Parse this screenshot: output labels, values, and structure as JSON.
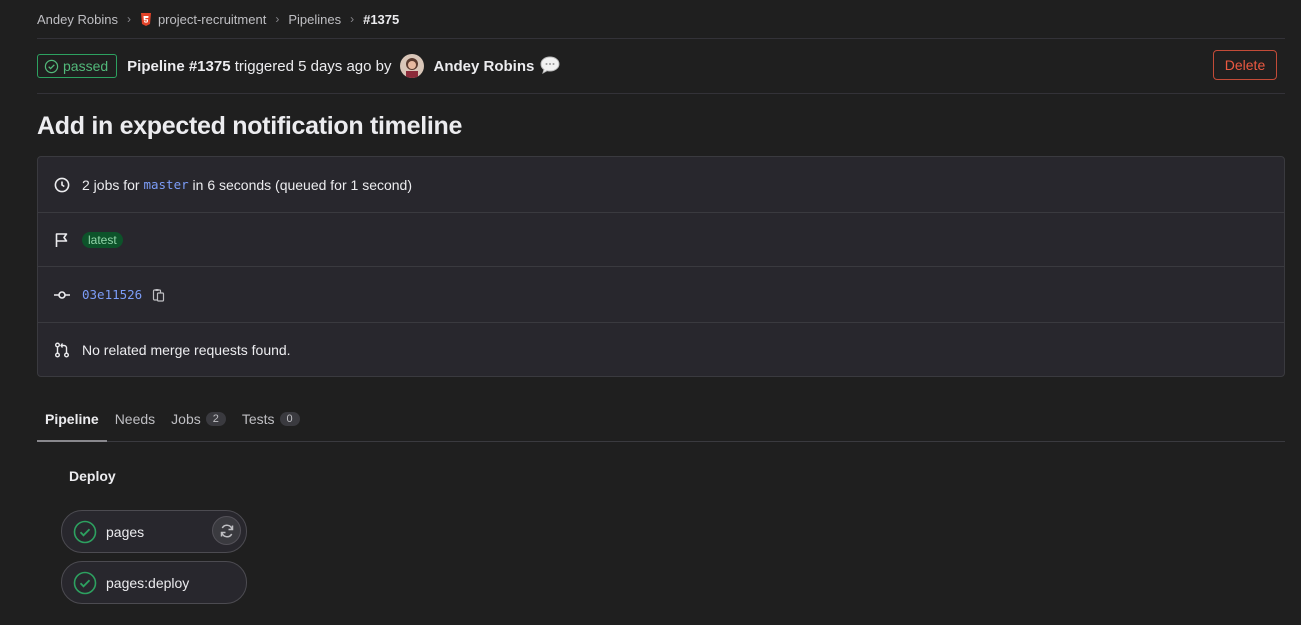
{
  "breadcrumb": {
    "items": [
      "Andey Robins",
      "project-recruitment",
      "Pipelines"
    ],
    "current": "#1375"
  },
  "header": {
    "status": "passed",
    "pipeline_label": "Pipeline #1375",
    "triggered_text": "triggered 5 days ago by",
    "author": "Andey Robins",
    "delete_label": "Delete"
  },
  "title": "Add in expected notification timeline",
  "info": {
    "jobs_prefix": "2 jobs for",
    "branch": "master",
    "jobs_suffix": "in 6 seconds (queued for 1 second)",
    "tag": "latest",
    "commit": "03e11526",
    "merge_requests": "No related merge requests found."
  },
  "tabs": [
    {
      "label": "Pipeline",
      "active": true
    },
    {
      "label": "Needs"
    },
    {
      "label": "Jobs",
      "count": "2"
    },
    {
      "label": "Tests",
      "count": "0"
    }
  ],
  "stage": {
    "title": "Deploy",
    "jobs": [
      {
        "name": "pages"
      },
      {
        "name": "pages:deploy"
      }
    ]
  },
  "colors": {
    "success": "#2da160",
    "danger": "#ec5941",
    "link": "#7c9df8",
    "background": "#1f1f1f"
  }
}
